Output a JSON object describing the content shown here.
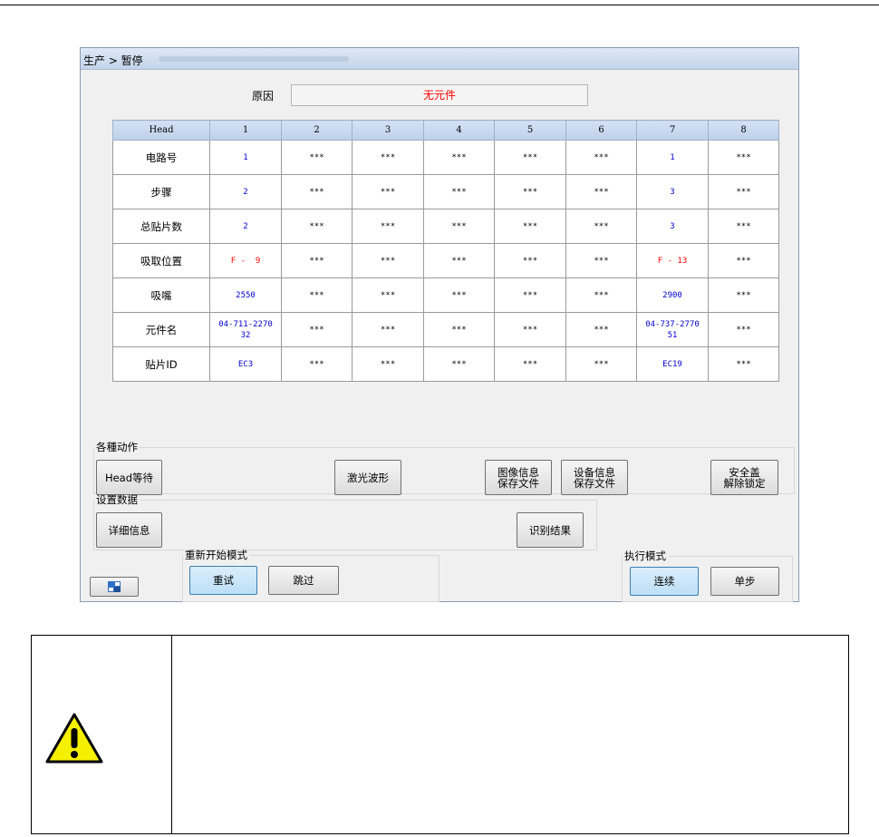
{
  "window": {
    "title": "生产 > 暂停"
  },
  "reason": {
    "label": "原因",
    "value": "无元件"
  },
  "table": {
    "header": [
      "Head",
      "1",
      "2",
      "3",
      "4",
      "5",
      "6",
      "7",
      "8"
    ],
    "rows": [
      {
        "label": "电路号",
        "cells": [
          "1",
          "***",
          "***",
          "***",
          "***",
          "***",
          "1",
          "***"
        ]
      },
      {
        "label": "步骤",
        "cells": [
          "2",
          "***",
          "***",
          "***",
          "***",
          "***",
          "3",
          "***"
        ]
      },
      {
        "label": "总贴片数",
        "cells": [
          "2",
          "***",
          "***",
          "***",
          "***",
          "***",
          "3",
          "***"
        ]
      },
      {
        "label": "吸取位置",
        "cells": [
          "F -  9",
          "***",
          "***",
          "***",
          "***",
          "***",
          "F - 13",
          "***"
        ]
      },
      {
        "label": "吸嘴",
        "cells": [
          "2550",
          "***",
          "***",
          "***",
          "***",
          "***",
          "2900",
          "***"
        ]
      },
      {
        "label": "元件名",
        "cells": [
          "04-711-227032",
          "***",
          "***",
          "***",
          "***",
          "***",
          "04-737-277051",
          "***"
        ]
      },
      {
        "label": "贴片ID",
        "cells": [
          "EC3",
          "***",
          "***",
          "***",
          "***",
          "***",
          "EC19",
          "***"
        ]
      }
    ]
  },
  "actions": {
    "legend": "各種动作",
    "head_wait": "Head等待",
    "laser_waveform": "激光波形",
    "save_image_info_1": "图像信息",
    "save_image_info_2": "保存文件",
    "save_device_info_1": "设备信息",
    "save_device_info_2": "保存文件",
    "safety_cover_1": "安全盖",
    "safety_cover_2": "解除锁定"
  },
  "settings": {
    "legend": "设置数据",
    "detail_info": "详细信息",
    "recognition_result": "识别结果"
  },
  "restart_mode": {
    "legend": "重新开始模式",
    "retry": "重试",
    "skip": "跳过"
  },
  "exec_mode": {
    "legend": "执行模式",
    "continuous": "连续",
    "step": "单步"
  },
  "colors": {
    "value_blue": "#0000cc",
    "alert_red": "#ff0000",
    "warning_yellow": "#f5ef00"
  },
  "icons": {
    "small_button_icon": "window-tile-icon",
    "warning": "warning-triangle-icon"
  }
}
